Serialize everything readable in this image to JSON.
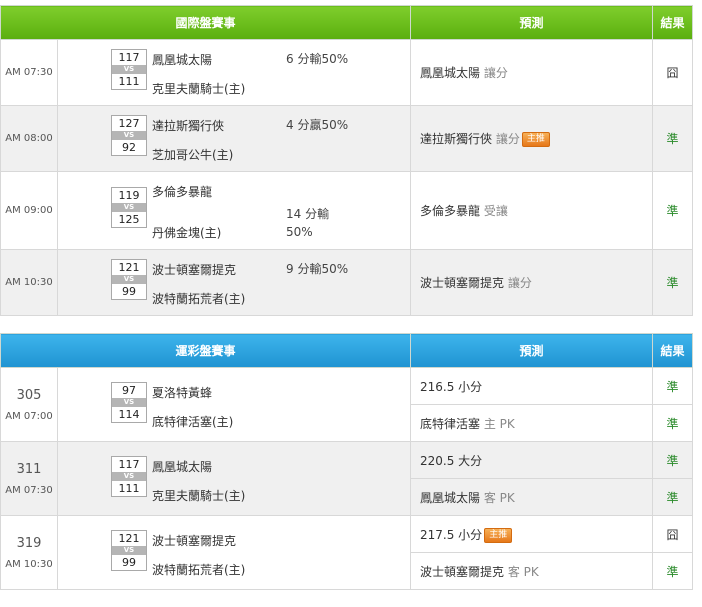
{
  "intl": {
    "header": {
      "game": "國際盤賽事",
      "predict": "預測",
      "result": "結果"
    },
    "rows": [
      {
        "time": "AM 07:30",
        "score_a": "117",
        "score_b": "111",
        "vs": "VS",
        "team_a": "鳳凰城太陽",
        "team_b": "克里夫蘭騎士(主)",
        "outcome": [
          "6 分輸50%"
        ],
        "pick": "鳳凰城太陽",
        "pick_sub": "讓分",
        "badge": "",
        "result": "囧",
        "result_state": "lose"
      },
      {
        "time": "AM 08:00",
        "score_a": "127",
        "score_b": "92",
        "vs": "VS",
        "team_a": "達拉斯獨行俠",
        "team_b": "芝加哥公牛(主)",
        "outcome": [
          "4 分贏50%"
        ],
        "pick": "達拉斯獨行俠",
        "pick_sub": "讓分",
        "badge": "主推",
        "result": "準",
        "result_state": "win"
      },
      {
        "time": "AM 09:00",
        "score_a": "119",
        "score_b": "125",
        "vs": "VS",
        "team_a": "多倫多暴龍",
        "team_b": "丹佛金塊(主)",
        "outcome": [
          "14 分輸",
          "50%"
        ],
        "pick": "多倫多暴龍",
        "pick_sub": "受讓",
        "badge": "",
        "result": "準",
        "result_state": "win"
      },
      {
        "time": "AM 10:30",
        "score_a": "121",
        "score_b": "99",
        "vs": "VS",
        "team_a": "波士頓塞爾提克",
        "team_b": "波特蘭拓荒者(主)",
        "outcome": [
          "9 分輸50%"
        ],
        "pick": "波士頓塞爾提克",
        "pick_sub": "讓分",
        "badge": "",
        "result": "準",
        "result_state": "win"
      }
    ]
  },
  "lottery": {
    "header": {
      "game": "運彩盤賽事",
      "predict": "預測",
      "result": "結果"
    },
    "rows": [
      {
        "num": "305",
        "time": "AM 07:00",
        "score_a": "97",
        "score_b": "114",
        "vs": "VS",
        "team_a": "夏洛特黃蜂",
        "team_b": "底特律活塞(主)",
        "picks": [
          {
            "main": "216.5 小分",
            "sub": "",
            "badge": "",
            "result": "準",
            "result_state": "win"
          },
          {
            "main": "底特律活塞",
            "sub": "主 PK",
            "badge": "",
            "result": "準",
            "result_state": "win"
          }
        ]
      },
      {
        "num": "311",
        "time": "AM 07:30",
        "score_a": "117",
        "score_b": "111",
        "vs": "VS",
        "team_a": "鳳凰城太陽",
        "team_b": "克里夫蘭騎士(主)",
        "picks": [
          {
            "main": "220.5 大分",
            "sub": "",
            "badge": "",
            "result": "準",
            "result_state": "win"
          },
          {
            "main": "鳳凰城太陽",
            "sub": "客 PK",
            "badge": "",
            "result": "準",
            "result_state": "win"
          }
        ]
      },
      {
        "num": "319",
        "time": "AM 10:30",
        "score_a": "121",
        "score_b": "99",
        "vs": "VS",
        "team_a": "波士頓塞爾提克",
        "team_b": "波特蘭拓荒者(主)",
        "picks": [
          {
            "main": "217.5 小分",
            "sub": "",
            "badge": "主推",
            "result": "囧",
            "result_state": "lose"
          },
          {
            "main": "波士頓塞爾提克",
            "sub": "客 PK",
            "badge": "",
            "result": "準",
            "result_state": "win"
          }
        ]
      }
    ]
  }
}
